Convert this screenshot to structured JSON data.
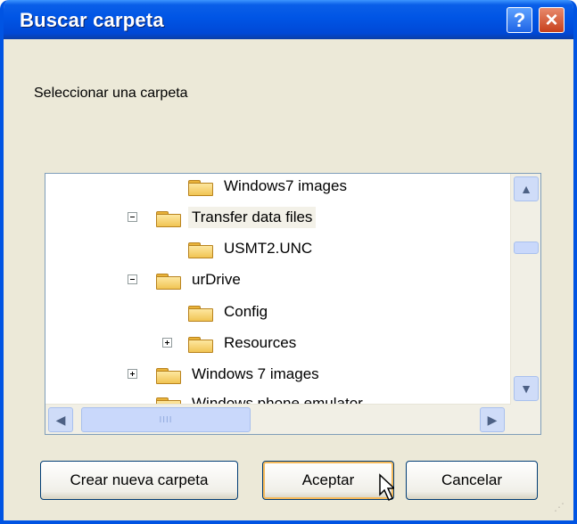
{
  "window": {
    "title": "Buscar carpeta",
    "help_symbol": "?",
    "close_symbol": "×"
  },
  "prompt": "Seleccionar una carpeta",
  "tree": {
    "items": [
      {
        "label": "Windows7 images"
      },
      {
        "label": "Transfer data files"
      },
      {
        "label": "USMT2.UNC"
      },
      {
        "label": "urDrive"
      },
      {
        "label": "Config"
      },
      {
        "label": "Resources"
      },
      {
        "label": "Windows 7 images"
      },
      {
        "label": "Windows phone emulator"
      }
    ]
  },
  "scroll": {
    "up": "▲",
    "down": "▼",
    "left": "◀",
    "right": "▶",
    "grip": "IIII"
  },
  "buttons": {
    "new_folder": "Crear nueva carpeta",
    "ok": "Aceptar",
    "cancel": "Cancelar"
  },
  "colors": {
    "title_bar": "#0055e5",
    "face": "#ece9d8",
    "selection": "#f3f1e8"
  }
}
